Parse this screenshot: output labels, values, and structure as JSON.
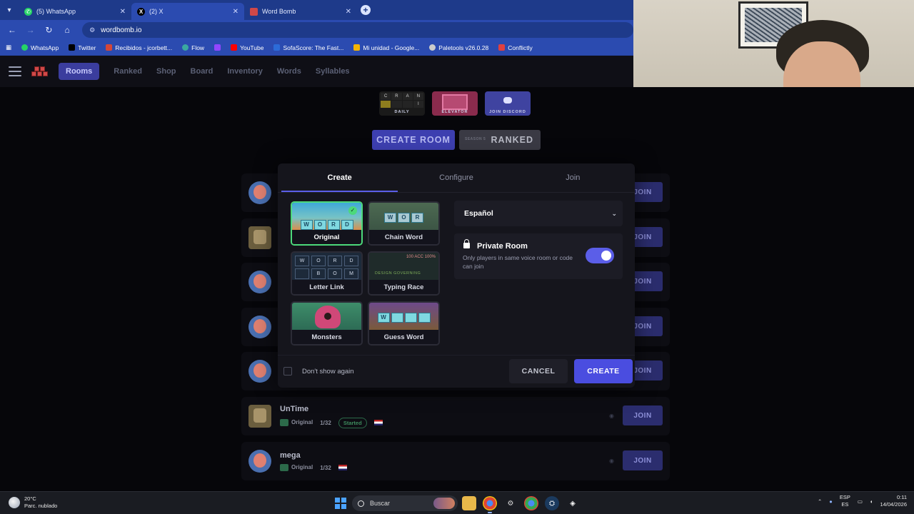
{
  "browser": {
    "tabs": [
      {
        "title": "(5) WhatsApp",
        "icon": "whatsapp-icon",
        "color": "#25d366",
        "active": false
      },
      {
        "title": "(2) X",
        "icon": "x-icon",
        "color": "#000000",
        "active": false
      },
      {
        "title": "Word Bomb",
        "icon": "wordbomb-icon",
        "color": "#d04848",
        "active": true
      }
    ],
    "url": "wordbomb.io",
    "bookmarks": [
      {
        "label": "WhatsApp",
        "color": "#25d366"
      },
      {
        "label": "Twitter",
        "color": "#000000"
      },
      {
        "label": "Recibidos - jcorbett...",
        "color": "#d44638"
      },
      {
        "label": "Flow",
        "color": "#3aa8a0"
      },
      {
        "label": "",
        "color": "#9146ff"
      },
      {
        "label": "YouTube",
        "color": "#ff0000"
      },
      {
        "label": "SofaScore: The Fast...",
        "color": "#2c6bd8"
      },
      {
        "label": "Mi unidad - Google...",
        "color": "#f4b400"
      },
      {
        "label": "Paletools v26.0.28",
        "color": "#cccccc"
      },
      {
        "label": "Conflictly",
        "color": "#e04040"
      }
    ]
  },
  "site": {
    "nav": [
      "Rooms",
      "Ranked",
      "Shop",
      "Board",
      "Inventory",
      "Words",
      "Syllables"
    ],
    "active_nav": "Rooms",
    "promos": {
      "daily": {
        "label": "DAILY",
        "letters": [
          "C",
          "R",
          "A",
          "N",
          "",
          "",
          "",
          "I"
        ]
      },
      "elevator": {
        "label": "ELEVATOR"
      },
      "discord": {
        "label": "JOIN DISCORD"
      }
    },
    "create_room_label": "CREATE ROOM",
    "ranked_label": "RANKED",
    "ranked_season": "SEASON 5",
    "rooms": [
      {
        "name": "",
        "mode": "",
        "players": "",
        "status": "",
        "join": "JOIN"
      },
      {
        "name": "",
        "mode": "",
        "players": "",
        "status": "",
        "join": "JOIN"
      },
      {
        "name": "",
        "mode": "",
        "players": "",
        "status": "",
        "join": "JOIN"
      },
      {
        "name": "",
        "mode": "",
        "players": "",
        "status": "",
        "join": "JOIN"
      },
      {
        "name": "",
        "mode": "",
        "players": "",
        "status": "",
        "join": "JOIN"
      },
      {
        "name": "UnTime",
        "mode": "Original",
        "players": "1/32",
        "status": "Started",
        "join": "JOIN"
      },
      {
        "name": "mega",
        "mode": "Original",
        "players": "1/32",
        "status": "",
        "join": "JOIN"
      }
    ]
  },
  "modal": {
    "tabs": [
      "Create",
      "Configure",
      "Join"
    ],
    "active_tab": "Create",
    "modes": [
      {
        "label": "Original",
        "selected": true,
        "art_letters": [
          "W",
          "O",
          "R",
          "D"
        ]
      },
      {
        "label": "Chain Word",
        "selected": false,
        "art_letters": [
          "W",
          "O",
          "R"
        ]
      },
      {
        "label": "Letter Link",
        "selected": false,
        "art_letters": [
          "W",
          "O",
          "R",
          "D",
          "",
          "B",
          "O",
          "M"
        ]
      },
      {
        "label": "Typing Race",
        "selected": false,
        "art_text": "DESIGN  GOVERNING",
        "art_top": "100  ACC 100%"
      },
      {
        "label": "Monsters",
        "selected": false
      },
      {
        "label": "Guess Word",
        "selected": false,
        "art_letters": [
          "W",
          "",
          "",
          ""
        ]
      }
    ],
    "language": "Español",
    "private_room": {
      "title": "Private Room",
      "description": "Only players in same voice room or code can join",
      "enabled": true
    },
    "dont_show_again": "Don't show again",
    "cancel_label": "CANCEL",
    "create_label": "CREATE"
  },
  "taskbar": {
    "weather_temp": "20°C",
    "weather_desc": "Parc. nublado",
    "search_placeholder": "Buscar",
    "lang_line1": "ESP",
    "lang_line2": "ES",
    "time": "0:11",
    "date": "14/04/2026"
  },
  "colors": {
    "accent": "#4a4de0",
    "selected_border": "#4cd97b",
    "browser_blue": "#2b4bb0"
  }
}
